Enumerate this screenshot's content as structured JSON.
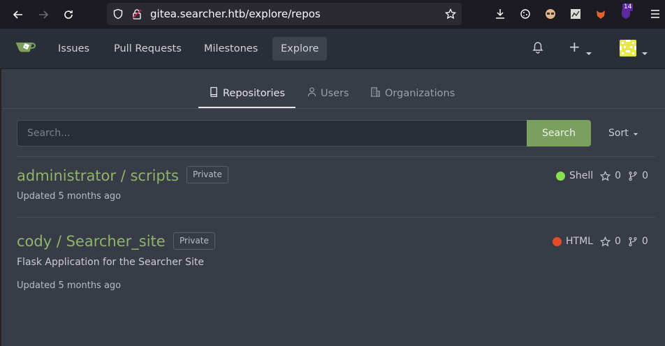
{
  "browser": {
    "url": "gitea.searcher.htb/explore/repos",
    "extension_badge": "14"
  },
  "nav": {
    "issues": "Issues",
    "pull_requests": "Pull Requests",
    "milestones": "Milestones",
    "explore": "Explore",
    "plus": "+"
  },
  "tabs": {
    "repositories": "Repositories",
    "users": "Users",
    "organizations": "Organizations"
  },
  "search": {
    "placeholder": "Search...",
    "button": "Search",
    "sort": "Sort"
  },
  "repos": [
    {
      "owner": "administrator",
      "name": "scripts",
      "full": "administrator / scripts",
      "visibility": "Private",
      "description": "",
      "language": "Shell",
      "language_color": "#89e051",
      "stars": "0",
      "forks": "0",
      "updated": "Updated 5 months ago"
    },
    {
      "owner": "cody",
      "name": "Searcher_site",
      "full": "cody / Searcher_site",
      "visibility": "Private",
      "description": "Flask Application for the Searcher Site",
      "language": "HTML",
      "language_color": "#e34c26",
      "stars": "0",
      "forks": "0",
      "updated": "Updated 5 months ago"
    }
  ],
  "colors": {
    "accent": "#7aa05e",
    "repo_link": "#8fb46a"
  }
}
